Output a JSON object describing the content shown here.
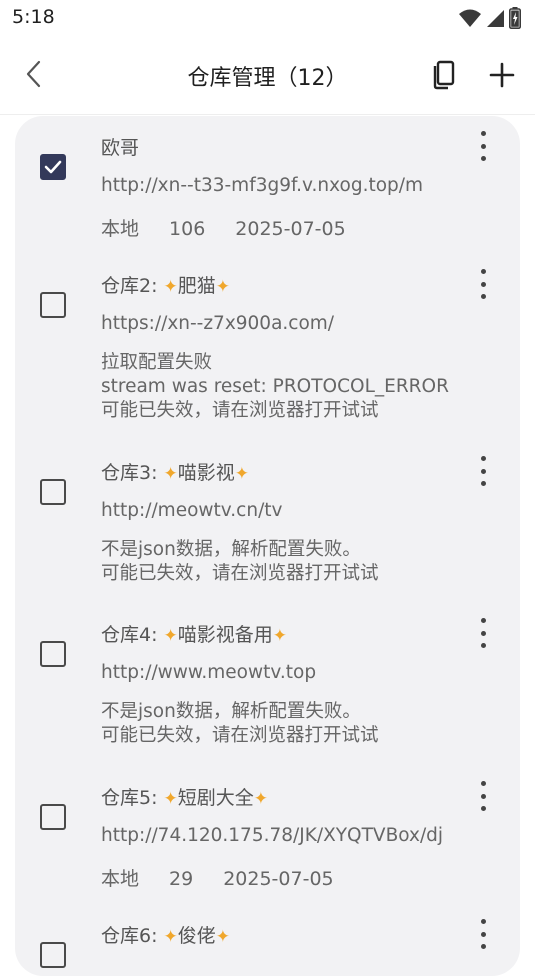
{
  "status_bar": {
    "time": "5:18",
    "icons": [
      "wifi-icon",
      "signal-icon",
      "battery-icon"
    ]
  },
  "app_bar": {
    "title": "仓库管理（12）",
    "back_icon": "chevron-left-icon",
    "copy_icon": "copy-icon",
    "add_icon": "plus-icon"
  },
  "accent_color": "#33395a",
  "repos": [
    {
      "checked": true,
      "name": "欧哥",
      "url": "http://xn--t33-mf3g9f.v.nxog.top/m",
      "source": "本地",
      "count": "106",
      "date": "2025-07-05"
    },
    {
      "checked": false,
      "name_prefix": "仓库2: ",
      "name_core": "肥猫",
      "url": "https://xn--z7x900a.com/",
      "error": [
        "拉取配置失败",
        "stream was reset: PROTOCOL_ERROR",
        "可能已失效，请在浏览器打开试试"
      ]
    },
    {
      "checked": false,
      "name_prefix": "仓库3: ",
      "name_core": "喵影视",
      "url": "http://meowtv.cn/tv",
      "error": [
        "不是json数据，解析配置失败。",
        "可能已失效，请在浏览器打开试试"
      ]
    },
    {
      "checked": false,
      "name_prefix": "仓库4: ",
      "name_core": "喵影视备用",
      "url": "http://www.meowtv.top",
      "error": [
        "不是json数据，解析配置失败。",
        "可能已失效，请在浏览器打开试试"
      ]
    },
    {
      "checked": false,
      "name_prefix": "仓库5: ",
      "name_core": "短剧大全",
      "url": "http://74.120.175.78/JK/XYQTVBox/dj",
      "source": "本地",
      "count": "29",
      "date": "2025-07-05"
    },
    {
      "checked": false,
      "name_prefix": "仓库6: ",
      "name_core": "俊佬"
    }
  ]
}
